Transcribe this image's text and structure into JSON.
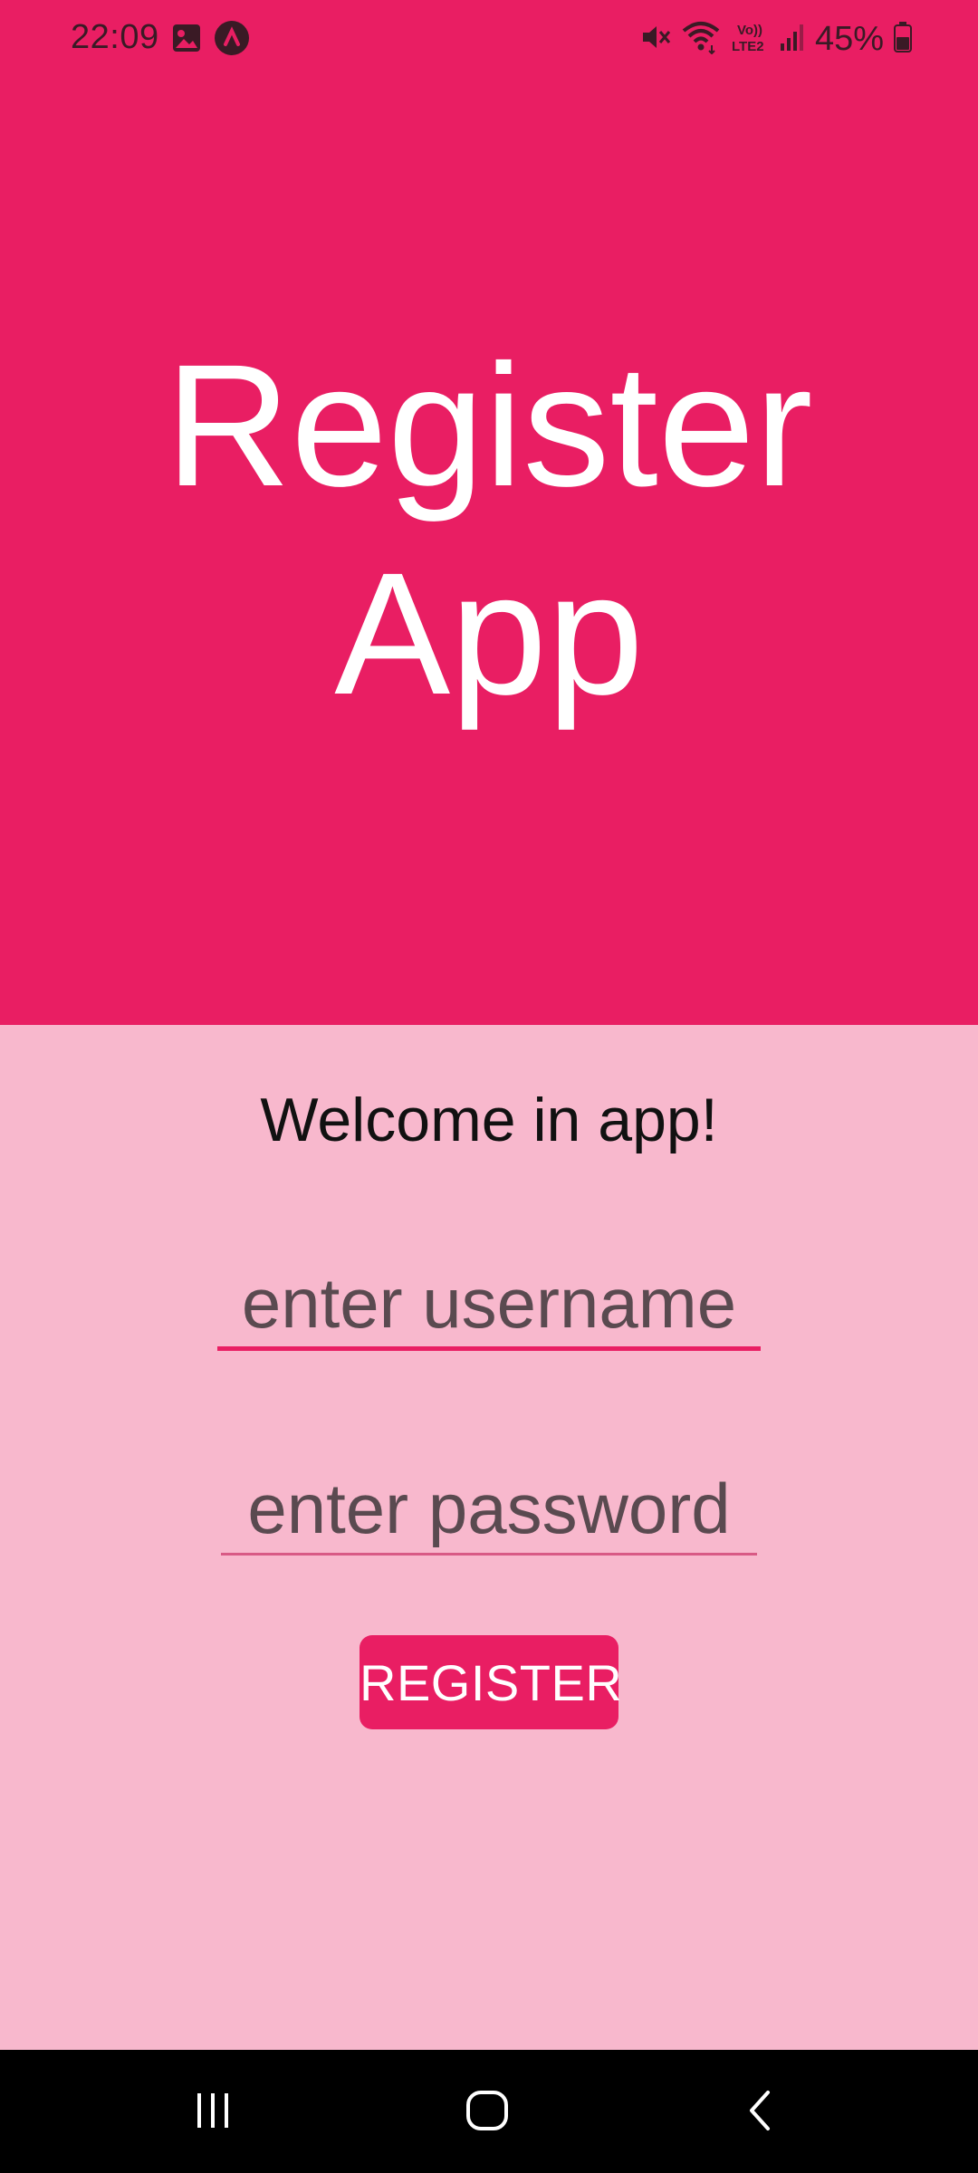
{
  "status_bar": {
    "time": "22:09",
    "battery": "45%",
    "icons": [
      "image-icon",
      "app-notification-icon",
      "mute-icon",
      "wifi-icon",
      "volte-lte2-icon",
      "signal-icon",
      "battery-icon"
    ]
  },
  "header": {
    "title_line1": "Register",
    "title_line2": "App"
  },
  "form": {
    "welcome_text": "Welcome in app!",
    "username_placeholder": "enter username",
    "password_placeholder": "enter password",
    "register_label": "REGISTER"
  },
  "nav_bar": {
    "buttons": [
      "recent-apps",
      "home",
      "back"
    ]
  },
  "colors": {
    "primary": "#e91e63",
    "background_light": "#f8b8cd",
    "nav_bar": "#000000"
  }
}
